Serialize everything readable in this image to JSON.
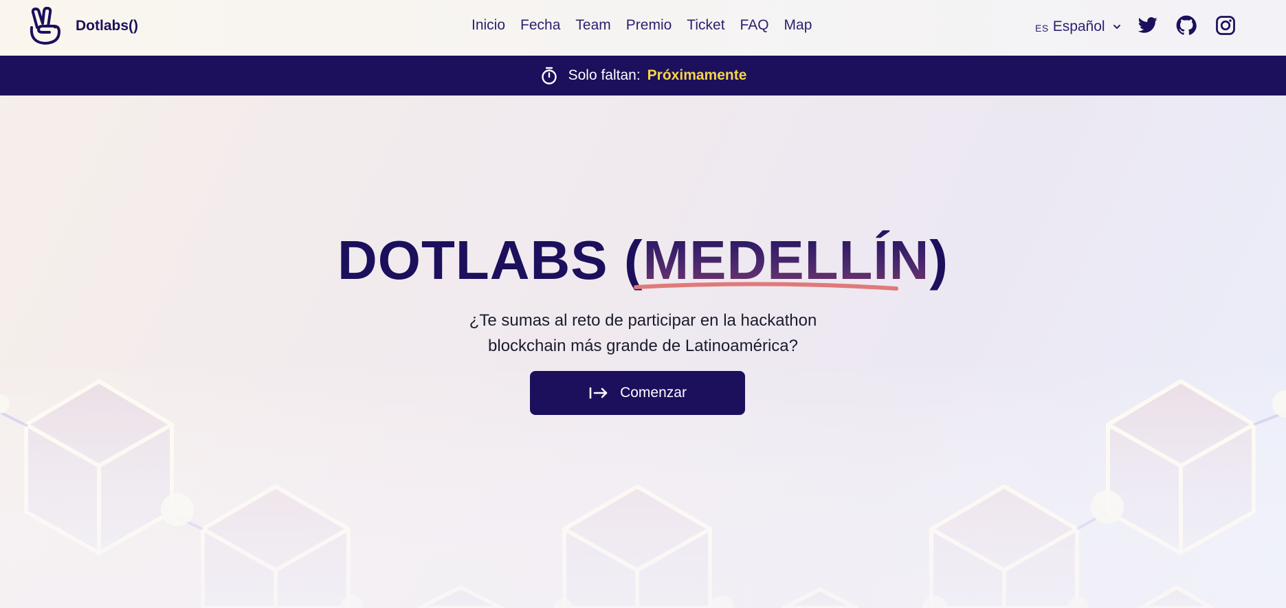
{
  "nav": {
    "brand": "Dotlabs()",
    "links": [
      "Inicio",
      "Fecha",
      "Team",
      "Premio",
      "Ticket",
      "FAQ",
      "Map"
    ],
    "language": {
      "code": "ES",
      "name": "Español"
    }
  },
  "banner": {
    "label": "Solo faltan:",
    "value": "Próximamente"
  },
  "hero": {
    "title_main": "DOTLABS (",
    "title_city": "MEDELLÍN",
    "title_close": ")",
    "subtitle_line1": "¿Te sumas al reto de participar en la hackathon",
    "subtitle_line2": "blockchain más grande de Latinoamérica?",
    "cta_label": "Comenzar"
  },
  "colors": {
    "primary": "#1c0f5c",
    "accent_yellow": "#f5d548",
    "underline": "#e07a7a"
  },
  "icons": {
    "logo": "peace-hand-icon",
    "banner": "stopwatch-icon",
    "cta": "arrow-right-from-bar-icon",
    "social": [
      "twitter-icon",
      "github-icon",
      "instagram-icon"
    ]
  }
}
